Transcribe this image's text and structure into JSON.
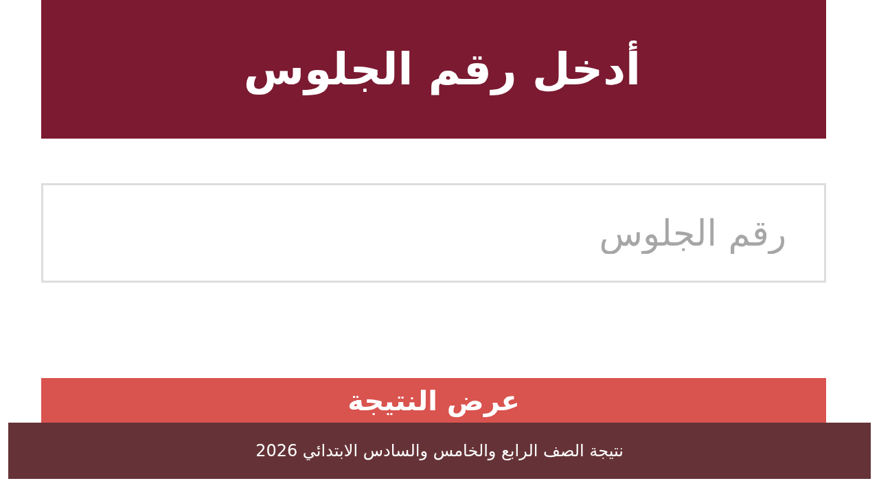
{
  "header": {
    "title": "أدخل رقم الجلوس"
  },
  "seat_number_field": {
    "placeholder": "رقم الجلوس"
  },
  "submit_button": {
    "label": "عرض النتيجة"
  },
  "caption": "نتيجة الصف الرابع والخامس والسادس الابتدائي 2026"
}
